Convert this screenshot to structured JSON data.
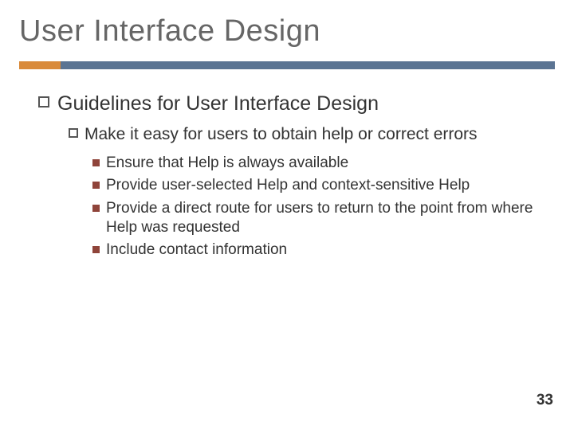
{
  "title": "User Interface Design",
  "level1": "Guidelines for User Interface Design",
  "level2": "Make it easy for users to obtain help or correct errors",
  "level3": [
    "Ensure that Help is always available",
    "Provide user-selected Help and context-sensitive Help",
    "Provide a direct route for users to return to the point from where Help was requested",
    "Include contact information"
  ],
  "page_number": "33",
  "colors": {
    "accent": "#d98a3a",
    "bar": "#5b7493",
    "square_bullet": "#8f443a"
  }
}
